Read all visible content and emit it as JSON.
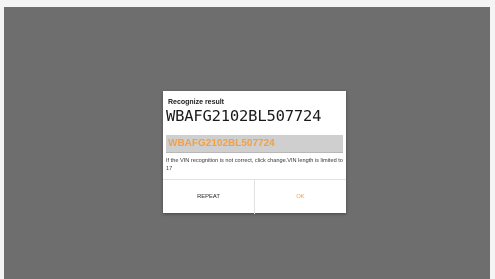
{
  "dialog": {
    "title": "Recognize result",
    "vin_recognized": "WBAFG2102BL507724",
    "vin_input_value": "WBAFG2102BL507724",
    "hint": "If the VIN recognition is not correct, click change.VIN length is limited to 17",
    "repeat_label": "REPEAT",
    "ok_label": "OK"
  },
  "colors": {
    "overlay": "#6e6e6e",
    "accent": "#f0a046",
    "input_background": "#cfcfcf"
  }
}
